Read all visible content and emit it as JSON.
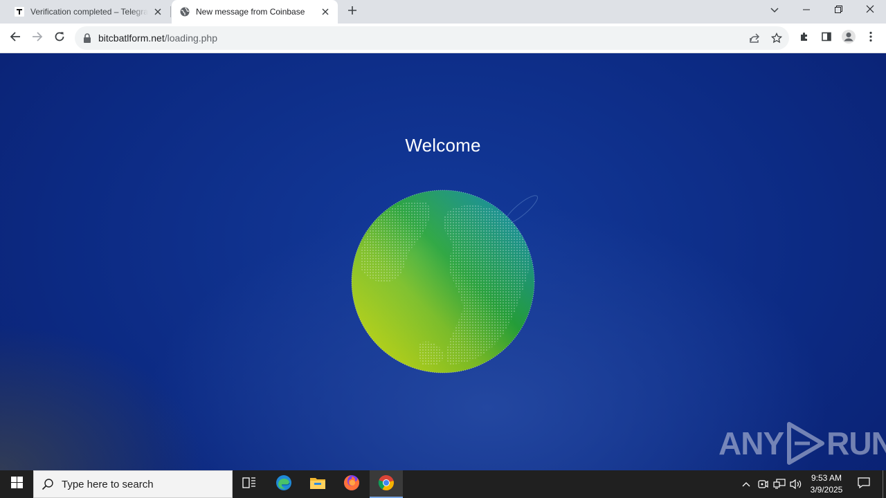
{
  "browser": {
    "tabs": [
      {
        "title": "Verification completed – Telegraph",
        "favicon": "telegraph-t-icon",
        "active": false
      },
      {
        "title": "New message from Coinbase",
        "favicon": "globe-icon",
        "active": true
      }
    ],
    "address": {
      "domain": "bitcbatlform.net",
      "path": "/loading.php"
    }
  },
  "page": {
    "heading": "Welcome"
  },
  "watermark": {
    "left": "ANY",
    "right": "RUN"
  },
  "taskbar": {
    "search_placeholder": "Type here to search",
    "apps": [
      "task-view-icon",
      "edge-icon",
      "file-explorer-icon",
      "firefox-icon",
      "chrome-icon"
    ],
    "clock": {
      "time": "9:53 AM",
      "date": "3/9/2025"
    }
  },
  "colors": {
    "page_bg": "#0f2f8a",
    "globe_light": "#b5d81c",
    "globe_mid": "#22a63c",
    "globe_dark": "#1a9aa8",
    "taskbar_bg": "#202020"
  }
}
